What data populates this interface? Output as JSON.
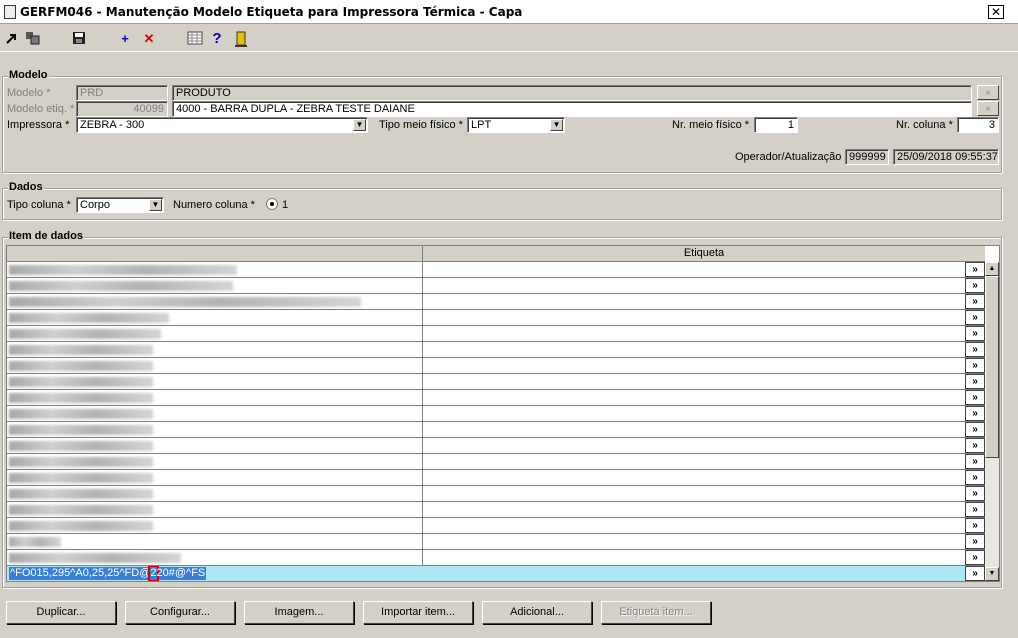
{
  "window": {
    "title": "GERFM046 - Manutenção Modelo Etiqueta para Impressora Térmica - Capa",
    "close_glyph": "✕"
  },
  "toolbar": {
    "icons": [
      "export-icon",
      "copy-icon",
      "save-icon",
      "add-icon",
      "delete-icon",
      "grid-icon",
      "help-icon",
      "exit-icon"
    ],
    "add_glyph": "+",
    "delete_glyph": "✕",
    "help_glyph": "?"
  },
  "modelo": {
    "section_label": "Modelo",
    "modelo_label": "Modelo *",
    "modelo_code": "PRD",
    "modelo_desc": "PRODUTO",
    "modelo_etiq_label": "Modelo etiq. *",
    "modelo_etiq_code": "40099",
    "modelo_etiq_desc": "4000 - BARRA DUPLA - ZEBRA TESTE DAIANE",
    "impressora_label": "Impressora *",
    "impressora_value": "ZEBRA - 300",
    "tipo_meio_label": "Tipo meio físico *",
    "tipo_meio_value": "LPT",
    "nr_meio_label": "Nr. meio físico *",
    "nr_meio_value": "1",
    "nr_coluna_label": "Nr. coluna *",
    "nr_coluna_value": "3",
    "operador_label": "Operador/Atualização",
    "operador_value": "999999",
    "atualizacao_value": "25/09/2018 09:55:37"
  },
  "dados": {
    "section_label": "Dados",
    "tipo_coluna_label": "Tipo coluna *",
    "tipo_coluna_value": "Corpo",
    "numero_coluna_label": "Numero coluna *",
    "numero_coluna_value": "1"
  },
  "itens": {
    "section_label": "Item de dados",
    "column_header": "Etiqueta",
    "more_glyph": "»",
    "row_count_visible": 19,
    "selected_row": {
      "text_before": "^FO015,295^A0,25,25^FD@",
      "text_marked": "2",
      "text_after": "20#@^FS"
    }
  },
  "buttons": {
    "duplicar": "Duplicar...",
    "configurar": "Configurar...",
    "imagem": "Imagem...",
    "importar": "Importar item...",
    "adicional": "Adicional...",
    "etiqueta_item": "Etiqueta item..."
  }
}
